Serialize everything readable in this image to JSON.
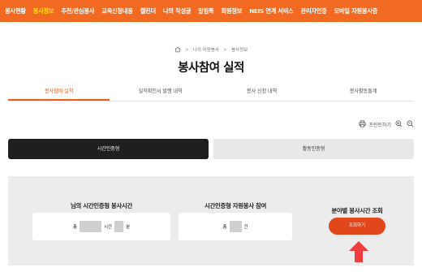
{
  "nav": {
    "items": [
      {
        "label": "봉사현황",
        "active": false
      },
      {
        "label": "봉사정보",
        "active": true
      },
      {
        "label": "추천/관심봉사",
        "active": false
      },
      {
        "label": "교육신청내용",
        "active": false
      },
      {
        "label": "캘린더",
        "active": false
      },
      {
        "label": "나의 작성글",
        "active": false
      },
      {
        "label": "알림톡",
        "active": false
      },
      {
        "label": "회원정보",
        "active": false
      },
      {
        "label": "NEIS 연계 서비스",
        "active": false
      },
      {
        "label": "관리자인증",
        "active": false
      },
      {
        "label": "모바일 자원봉사증",
        "active": false
      }
    ]
  },
  "breadcrumb": {
    "home_icon": "home-icon",
    "items": [
      "나의 자원봉사",
      "봉사정보"
    ]
  },
  "page_title": "봉사참여 실적",
  "tabs": [
    {
      "label": "봉사참여 실적",
      "active": true
    },
    {
      "label": "실적확인서 발행 내역",
      "active": false
    },
    {
      "label": "봉사 신청 내역",
      "active": false
    },
    {
      "label": "봉사활동통계",
      "active": false
    }
  ],
  "tools": {
    "print_label": "프린트하기",
    "print_icon": "print-icon",
    "zoom_in_icon": "zoom-in-icon",
    "zoom_out_icon": "zoom-out-icon"
  },
  "type_buttons": {
    "time_cert": "시간인증형",
    "activity_cert": "활동인증형"
  },
  "summary": {
    "hours_title": "님의 시간인증형 봉사시간",
    "hours_prefix": "총",
    "hours_unit": "시간",
    "minutes_unit": "분",
    "count_title": "시간인증형 자원봉사 참여",
    "count_prefix": "총",
    "count_unit": "건",
    "field_title": "분야별 봉사시간 조회",
    "lookup_label": "조회하기"
  },
  "colors": {
    "nav_bg": "#f26a21",
    "nav_active": "#ffe11a",
    "accent": "#e8601c",
    "lookup_btn": "#e2461b",
    "arrow": "#f03c3c"
  }
}
